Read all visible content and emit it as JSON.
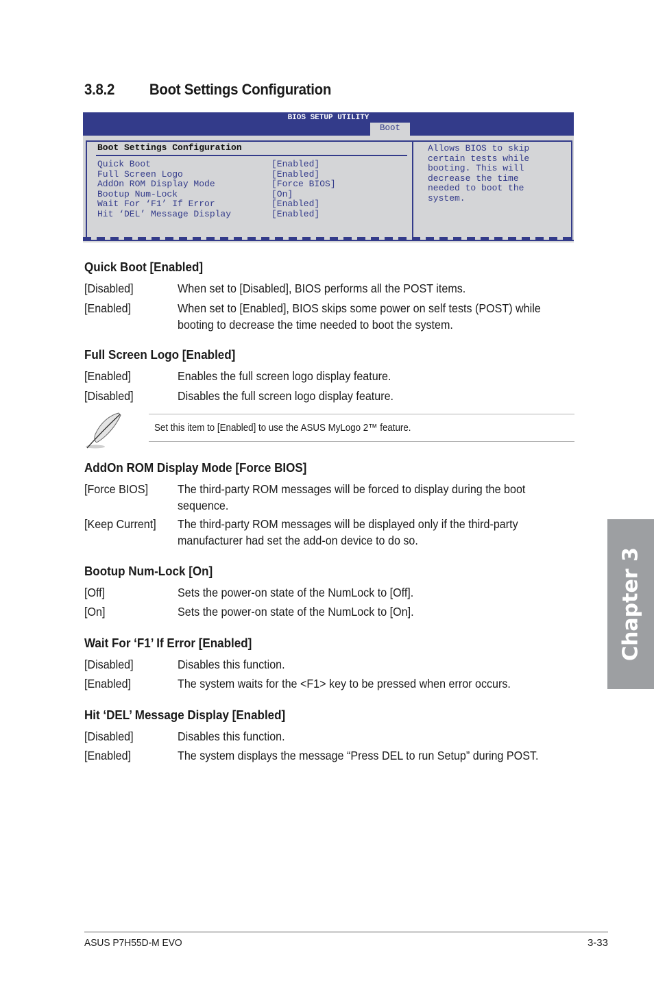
{
  "section": {
    "number": "3.8.2",
    "title": "Boot Settings Configuration"
  },
  "bios": {
    "utility_title": "BIOS SETUP UTILITY",
    "active_tab": "Boot",
    "panel_heading": "Boot Settings Configuration",
    "items": [
      {
        "label": "Quick Boot",
        "value": "[Enabled]"
      },
      {
        "label": "Full Screen Logo",
        "value": "[Enabled]"
      },
      {
        "label": "AddOn ROM Display Mode",
        "value": "[Force BIOS]"
      },
      {
        "label": "Bootup Num-Lock",
        "value": "[On]"
      },
      {
        "label": "Wait For ‘F1’ If Error",
        "value": "[Enabled]"
      },
      {
        "label": "Hit ‘DEL’ Message Display",
        "value": "[Enabled]"
      }
    ],
    "help_text": "Allows BIOS to skip\ncertain tests while\nbooting. This will\ndecrease the time\nneeded to boot the\nsystem."
  },
  "settings": [
    {
      "title": "Quick Boot [Enabled]",
      "options": [
        {
          "key": "[Disabled]",
          "desc": "When set to [Disabled], BIOS performs all the POST items."
        },
        {
          "key": "[Enabled]",
          "desc": "When set to [Enabled], BIOS skips some power on self tests (POST) while booting to decrease the time needed to boot the system."
        }
      ]
    },
    {
      "title": "Full Screen Logo [Enabled]",
      "options": [
        {
          "key": "[Enabled]",
          "desc": "Enables the full screen logo display feature."
        },
        {
          "key": "[Disabled]",
          "desc": "Disables the full screen logo display feature."
        }
      ]
    },
    {
      "title": "AddOn ROM Display Mode [Force BIOS]",
      "options": [
        {
          "key": "[Force BIOS]",
          "desc": "The third-party ROM messages will be forced to display during the boot sequence."
        },
        {
          "key": "[Keep Current]",
          "desc": "The third-party ROM messages will be displayed only if the third-party manufacturer had set the add-on device to do so."
        }
      ]
    },
    {
      "title": "Bootup Num-Lock [On]",
      "options": [
        {
          "key": "[Off]",
          "desc": "Sets the power-on state of the NumLock to [Off]."
        },
        {
          "key": "[On]",
          "desc": "Sets the power-on state of the NumLock to [On]."
        }
      ]
    },
    {
      "title": "Wait For ‘F1’ If Error [Enabled]",
      "options": [
        {
          "key": "[Disabled]",
          "desc": "Disables this function."
        },
        {
          "key": "[Enabled]",
          "desc": "The system waits for the <F1> key to be pressed when error occurs."
        }
      ]
    },
    {
      "title": "Hit ‘DEL’ Message Display [Enabled]",
      "options": [
        {
          "key": "[Disabled]",
          "desc": "Disables this function."
        },
        {
          "key": "[Enabled]",
          "desc": "The system displays the message “Press DEL to run Setup” during POST."
        }
      ]
    }
  ],
  "note": {
    "icon": "feather-pen-icon",
    "text": "Set this item to [Enabled] to use the ASUS MyLogo 2™ feature."
  },
  "chapter_tab": "Chapter 3",
  "footer": {
    "product": "ASUS P7H55D-M EVO",
    "page": "3-33"
  },
  "colors": {
    "bios_blue": "#333b8a",
    "bios_gray": "#d4d5d7",
    "chapter_tab_gray": "#9d9fa2"
  }
}
